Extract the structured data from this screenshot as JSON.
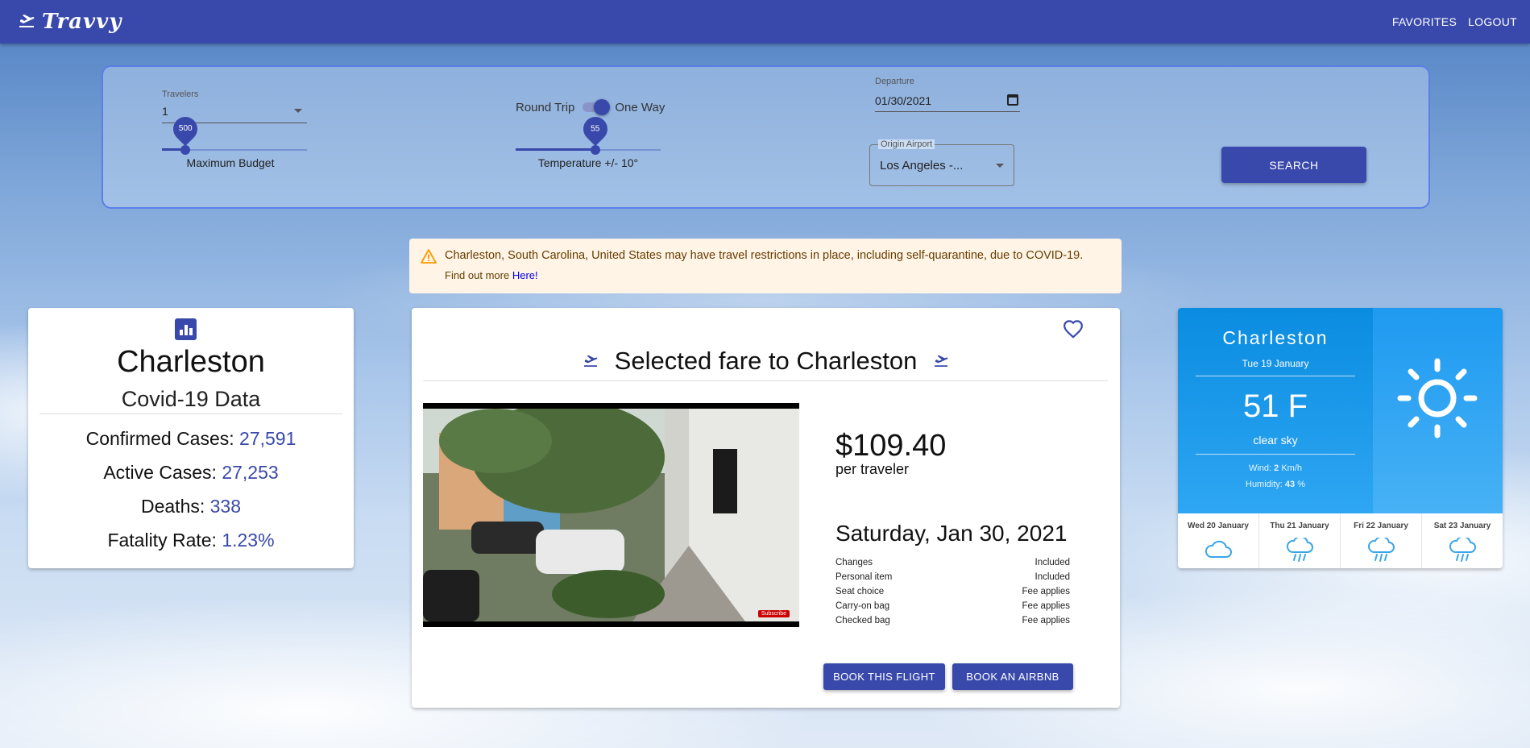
{
  "app": {
    "name": "Travvy",
    "nav": {
      "favorites": "FAVORITES",
      "logout": "LOGOUT"
    }
  },
  "search": {
    "travelers_label": "Travelers",
    "travelers_value": "1",
    "trip_toggle": {
      "left": "Round Trip",
      "right": "One Way",
      "state": "one-way"
    },
    "budget": {
      "value": "500",
      "label": "Maximum Budget",
      "fraction": 0.16
    },
    "temperature": {
      "value": "55",
      "label": "Temperature +/- 10°",
      "fraction": 0.55
    },
    "departure_label": "Departure",
    "departure_value": "01/30/2021",
    "origin_label": "Origin Airport",
    "origin_value": "Los Angeles -...",
    "search_button": "SEARCH"
  },
  "alert": {
    "message": "Charleston, South Carolina, United States may have travel restrictions in place, including self-quarantine, due to COVID-19.",
    "more_text": "Find out more",
    "link_text": "Here!"
  },
  "covid": {
    "city": "Charleston",
    "subtitle": "Covid-19 Data",
    "rows": [
      {
        "label": "Confirmed Cases: ",
        "value": "27,591"
      },
      {
        "label": "Active Cases: ",
        "value": "27,253"
      },
      {
        "label": "Deaths: ",
        "value": "338"
      },
      {
        "label": "Fatality Rate: ",
        "value": "1.23%"
      }
    ]
  },
  "fare": {
    "title": "Selected fare to Charleston",
    "price": "$109.40",
    "per": "per traveler",
    "date": "Saturday, Jan 30, 2021",
    "features": [
      {
        "name": "Changes",
        "value": "Included"
      },
      {
        "name": "Personal item",
        "value": "Included"
      },
      {
        "name": "Seat choice",
        "value": "Fee applies"
      },
      {
        "name": "Carry-on bag",
        "value": "Fee applies"
      },
      {
        "name": "Checked bag",
        "value": "Fee applies"
      }
    ],
    "book_flight": "BOOK THIS FLIGHT",
    "book_airbnb": "BOOK AN AIRBNB",
    "video_badge": "Subscribe"
  },
  "weather": {
    "city": "Charleston",
    "date": "Tue 19 January",
    "temp": "51 F",
    "desc": "clear sky",
    "wind_label": "Wind: ",
    "wind_value": "2",
    "wind_unit": " Km/h",
    "humidity_label": "Humidity: ",
    "humidity_value": "43",
    "humidity_unit": " %",
    "forecast": [
      {
        "day": "Wed 20 January",
        "icon": "cloud-icon"
      },
      {
        "day": "Thu 21 January",
        "icon": "rain-cloud-icon"
      },
      {
        "day": "Fri 22 January",
        "icon": "rain-cloud-icon"
      },
      {
        "day": "Sat 23 January",
        "icon": "rain-cloud-icon"
      }
    ]
  },
  "colors": {
    "primary": "#3949ab",
    "alert_bg": "#fff4e5",
    "weather_blue": "#1e9af0",
    "forecast_icon": "#3aa6e8"
  }
}
